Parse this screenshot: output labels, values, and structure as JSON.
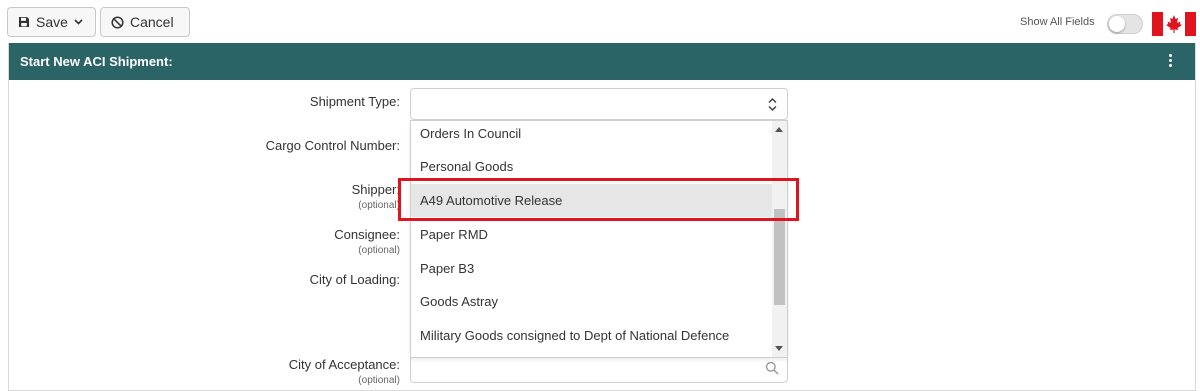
{
  "toolbar": {
    "save_label": "Save",
    "cancel_label": "Cancel",
    "show_all_fields_label": "Show All Fields"
  },
  "panel": {
    "title": "Start New ACI Shipment:"
  },
  "form": {
    "shipment_type_label": "Shipment Type:",
    "cargo_control_number_label": "Cargo Control Number:",
    "shipper_label": "Shipper:",
    "shipper_optional": "(optional)",
    "consignee_label": "Consignee:",
    "consignee_optional": "(optional)",
    "city_of_loading_label": "City of Loading:",
    "city_of_acceptance_label": "City of Acceptance:",
    "city_of_acceptance_optional": "(optional)"
  },
  "dropdown": {
    "options": [
      "Orders In Council",
      "Personal Goods",
      "A49 Automotive Release",
      "Paper RMD",
      "Paper B3",
      "Goods Astray",
      "Military Goods consigned to Dept of National Defence"
    ],
    "highlighted": "A49 Automotive Release"
  },
  "colors": {
    "header_bg": "#2b6466",
    "highlight_box": "#e0141e"
  },
  "icons": {
    "save": "floppy-disk-icon",
    "save_dropdown": "chevron-down-icon",
    "cancel": "ban-icon",
    "flag": "canada-flag-icon",
    "menu": "kebab-menu-icon",
    "select": "updown-chevron-icon",
    "search": "search-icon"
  }
}
